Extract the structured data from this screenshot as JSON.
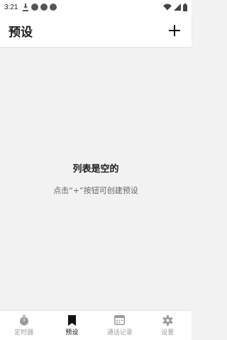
{
  "status_bar": {
    "time": "3:21",
    "left_icons": [
      "download-icon",
      "notification-dot",
      "notification-dot",
      "notification-dot"
    ],
    "right_icons": [
      "wifi-icon",
      "signal-icon",
      "battery-icon"
    ]
  },
  "app_bar": {
    "title": "预设",
    "action_icon": "plus-icon"
  },
  "empty_state": {
    "title": "列表是空的",
    "hint": "点击“+”按钮可创建预设"
  },
  "bottom_nav": {
    "items": [
      {
        "label": "定时器",
        "icon": "stopwatch-icon",
        "active": false
      },
      {
        "label": "预设",
        "icon": "bookmark-icon",
        "active": true
      },
      {
        "label": "通话记录",
        "icon": "call-log-icon",
        "active": false
      },
      {
        "label": "设置",
        "icon": "gear-icon",
        "active": false
      }
    ]
  },
  "colors": {
    "background": "#f2f2f2",
    "surface": "#ffffff",
    "active": "#111111",
    "inactive": "#9a9a9a"
  }
}
